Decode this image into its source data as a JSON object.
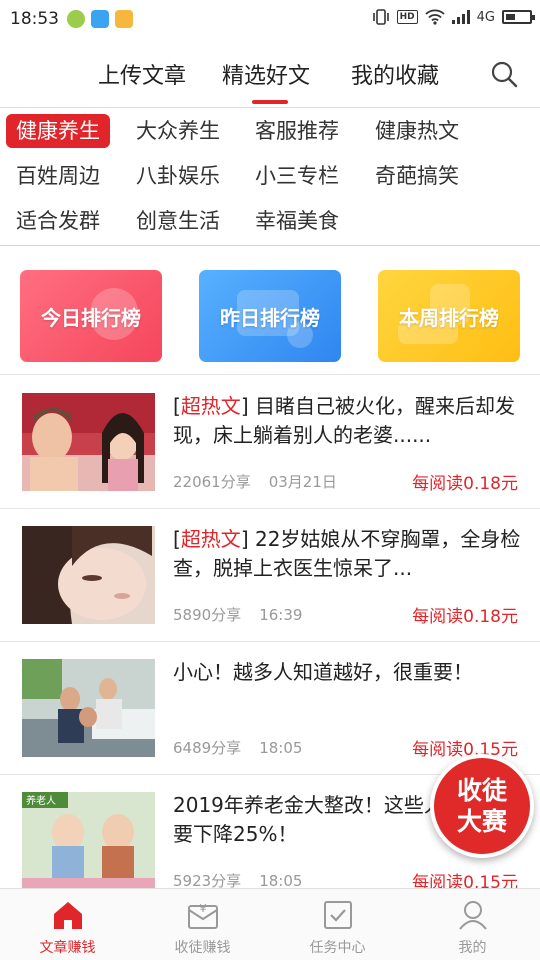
{
  "status_bar": {
    "time": "18:53",
    "network": "4G",
    "hd_label": "HD"
  },
  "top_nav": {
    "tabs": [
      "上传文章",
      "精选好文",
      "我的收藏"
    ],
    "active_tab": 1
  },
  "categories": [
    "健康养生",
    "大众养生",
    "客服推荐",
    "健康热文",
    "百姓周边",
    "八卦娱乐",
    "小三专栏",
    "奇葩搞笑",
    "适合发群",
    "创意生活",
    "幸福美食"
  ],
  "rankings": [
    "今日排行榜",
    "昨日排行榜",
    "本周排行榜"
  ],
  "articles": [
    {
      "tag_open": "[",
      "tag": "超热文",
      "tag_close": "]",
      "title": " 目睹自己被火化，醒来后却发现，床上躺着别人的老婆......",
      "shares": "22061分享",
      "time": "03月21日",
      "reward": "每阅读0.18元"
    },
    {
      "tag_open": "[",
      "tag": "超热文",
      "tag_close": "]",
      "title": " 22岁姑娘从不穿胸罩，全身检查，脱掉上衣医生惊呆了...",
      "shares": "5890分享",
      "time": "16:39",
      "reward": "每阅读0.18元"
    },
    {
      "title": "小心！越多人知道越好，很重要！",
      "shares": "6489分享",
      "time": "18:05",
      "reward": "每阅读0.15元"
    },
    {
      "title": "2019年养老金大整改！这些人养老金要下降25%！",
      "shares": "5923分享",
      "time": "18:05",
      "reward": "每阅读0.15元",
      "thumb_text": "养老人"
    }
  ],
  "float_badge": {
    "line1": "收徒",
    "line2": "大赛"
  },
  "bottom_nav": [
    {
      "label": "文章赚钱",
      "icon": "home-icon"
    },
    {
      "label": "收徒赚钱",
      "icon": "yuan-envelope-icon"
    },
    {
      "label": "任务中心",
      "icon": "task-check-icon"
    },
    {
      "label": "我的",
      "icon": "user-icon"
    }
  ],
  "colors": {
    "accent": "#e0262b",
    "rank_today": "#f5465c",
    "rank_yesterday": "#2f86f0",
    "rank_week": "#ffbe13"
  }
}
